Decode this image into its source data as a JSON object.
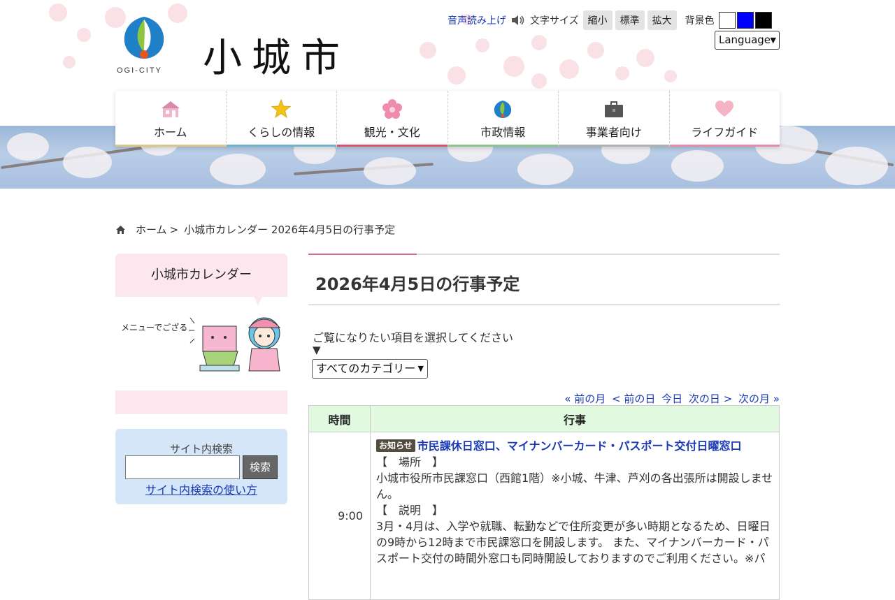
{
  "site": {
    "logo_caption": "OGI-CITY",
    "title": "小城市"
  },
  "utility": {
    "voice_label": "音声読み上げ",
    "font_size_label": "文字サイズ",
    "font_buttons": [
      "縮小",
      "標準",
      "拡大"
    ],
    "bg_color_label": "背景色",
    "bg_swatches": [
      "#ffffff",
      "#0000ff",
      "#000000"
    ],
    "language": "Language"
  },
  "nav": [
    {
      "label": "ホーム",
      "icon": "house-icon",
      "color": "#d9c68a"
    },
    {
      "label": "くらしの情報",
      "icon": "star-icon",
      "color": "#6fb3cc"
    },
    {
      "label": "観光・文化",
      "icon": "sakura-icon",
      "color": "#d9536a"
    },
    {
      "label": "市政情報",
      "icon": "city-emblem-icon",
      "color": "#8cc490"
    },
    {
      "label": "事業者向け",
      "icon": "briefcase-icon",
      "color": "#b0b0b0"
    },
    {
      "label": "ライフガイド",
      "icon": "heart-icon",
      "color": "#e58aa8"
    }
  ],
  "breadcrumb": {
    "home": "ホーム",
    "sep": ">",
    "current": "小城市カレンダー 2026年4月5日の行事予定"
  },
  "sidebar": {
    "title": "小城市カレンダー",
    "mascot_speech": "メニューでござる",
    "search_label": "サイト内検索",
    "search_value": "",
    "search_button": "検索",
    "search_help": "サイト内検索の使い方"
  },
  "main": {
    "heading": "2026年4月5日の行事予定",
    "prompt": "ご覧になりたい項目を選択してください",
    "triangle": "▼",
    "category_selected": "すべてのカテゴリー",
    "pager": {
      "prev_month": "« 前の月",
      "prev_day": "< 前の日",
      "today": "今日",
      "next_day": "次の日 >",
      "next_month": "次の月 »"
    },
    "table": {
      "col_time": "時間",
      "col_event": "行事",
      "rows": [
        {
          "time": "9:00",
          "badge": "お知らせ",
          "title": "市民課休日窓口、マイナンバーカード・パスポート交付日曜窓口",
          "place_label": "【　場所　】",
          "place": "小城市役所市民課窓口（西館1階）※小城、牛津、芦刈の各出張所は開設しません。",
          "desc_label": "【　説明　】",
          "desc": "3月・4月は、入学や就職、転勤などで住所変更が多い時期となるため、日曜日の9時から12時まで市民課窓口を開設します。 また、マイナンバーカード・パスポート交付の時間外窓口も同時開設しておりますのでご利用ください。※パ"
        }
      ]
    }
  }
}
